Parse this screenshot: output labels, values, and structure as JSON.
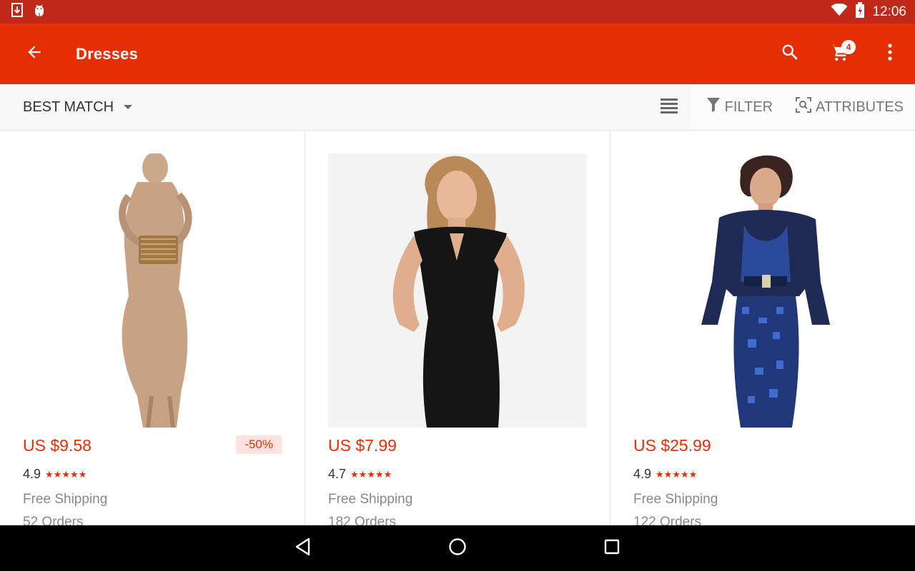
{
  "status_bar": {
    "time": "12:06",
    "icons": [
      "download-icon",
      "android-debug-icon",
      "wifi-icon",
      "battery-icon"
    ]
  },
  "app_bar": {
    "title": "Dresses",
    "cart_count": "4",
    "icons": [
      "back-arrow-icon",
      "search-icon",
      "cart-icon",
      "more-vert-icon"
    ]
  },
  "toolbar": {
    "sort_label": "BEST MATCH",
    "filter_label": "FILTER",
    "attributes_label": "ATTRIBUTES"
  },
  "products": [
    {
      "price": "US $9.58",
      "discount": "-50%",
      "rating": "4.9",
      "stars": "★★★★★",
      "shipping": "Free Shipping",
      "orders": "52 Orders"
    },
    {
      "price": "US $7.99",
      "rating": "4.7",
      "stars": "★★★★★",
      "shipping": "Free Shipping",
      "orders": "182 Orders"
    },
    {
      "price": "US $25.99",
      "rating": "4.9",
      "stars": "★★★★★",
      "shipping": "Free Shipping",
      "orders": "122 Orders"
    }
  ],
  "colors": {
    "accent": "#e62e04",
    "status_bar": "#c0281a",
    "discount_bg": "#fde3e0"
  }
}
